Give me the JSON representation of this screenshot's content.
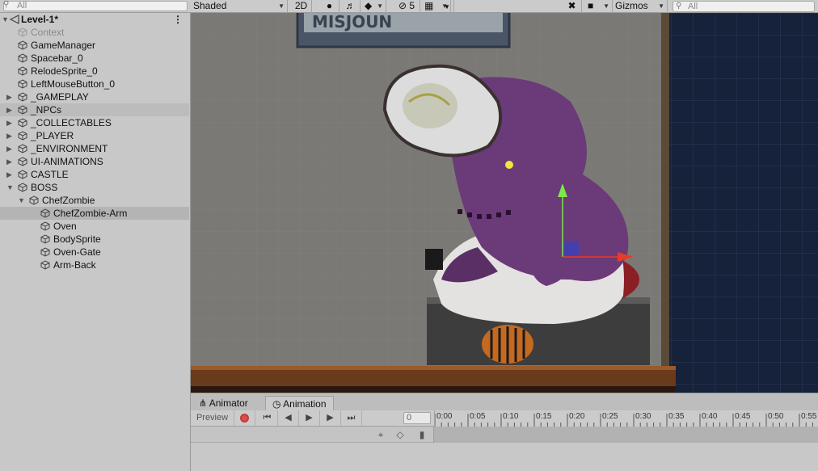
{
  "hierarchy": {
    "search_placeholder": "All",
    "scene_name": "Level-1*",
    "items": [
      {
        "label": "Context",
        "depth": 1,
        "expander": "none",
        "disabled": true
      },
      {
        "label": "GameManager",
        "depth": 1,
        "expander": "none"
      },
      {
        "label": "Spacebar_0",
        "depth": 1,
        "expander": "none"
      },
      {
        "label": "RelodeSprite_0",
        "depth": 1,
        "expander": "none"
      },
      {
        "label": "LeftMouseButton_0",
        "depth": 1,
        "expander": "none"
      },
      {
        "label": "_GAMEPLAY",
        "depth": 1,
        "expander": "collapsed"
      },
      {
        "label": "_NPCs",
        "depth": 1,
        "expander": "collapsed",
        "highlighted": true
      },
      {
        "label": "_COLLECTABLES",
        "depth": 1,
        "expander": "collapsed"
      },
      {
        "label": "_PLAYER",
        "depth": 1,
        "expander": "collapsed"
      },
      {
        "label": "_ENVIRONMENT",
        "depth": 1,
        "expander": "collapsed"
      },
      {
        "label": "UI-ANIMATIONS",
        "depth": 1,
        "expander": "collapsed"
      },
      {
        "label": "CASTLE",
        "depth": 1,
        "expander": "collapsed"
      },
      {
        "label": "BOSS",
        "depth": 1,
        "expander": "expanded"
      },
      {
        "label": "ChefZombie",
        "depth": 2,
        "expander": "expanded"
      },
      {
        "label": "ChefZombie-Arm",
        "depth": 3,
        "expander": "none",
        "selected": true
      },
      {
        "label": "Oven",
        "depth": 3,
        "expander": "none"
      },
      {
        "label": "BodySprite",
        "depth": 3,
        "expander": "none"
      },
      {
        "label": "Oven-Gate",
        "depth": 3,
        "expander": "none"
      },
      {
        "label": "Arm-Back",
        "depth": 3,
        "expander": "none"
      }
    ]
  },
  "scene_toolbar": {
    "shading_mode": "Shaded",
    "mode_2d": "2D",
    "hidden_count": "5",
    "gizmos": "Gizmos",
    "search_placeholder": "All"
  },
  "animation_panel": {
    "tabs": [
      {
        "label": "Animator",
        "icon": "animator-icon",
        "active": false
      },
      {
        "label": "Animation",
        "icon": "animation-clock-icon",
        "active": true
      }
    ],
    "preview_label": "Preview",
    "frame_value": "0",
    "timeline_ticks": [
      "0:00",
      "0:05",
      "0:10",
      "0:15",
      "0:20",
      "0:25",
      "0:30",
      "0:35",
      "0:40",
      "0:45",
      "0:50",
      "0:55"
    ]
  },
  "colors": {
    "selection": "#b4b4b4",
    "scene_bg": "#767572",
    "dark_panel": "#16213a",
    "zombie_purple": "#6b3a78",
    "gizmo_y": "#7de848",
    "gizmo_x": "#e83a28"
  }
}
